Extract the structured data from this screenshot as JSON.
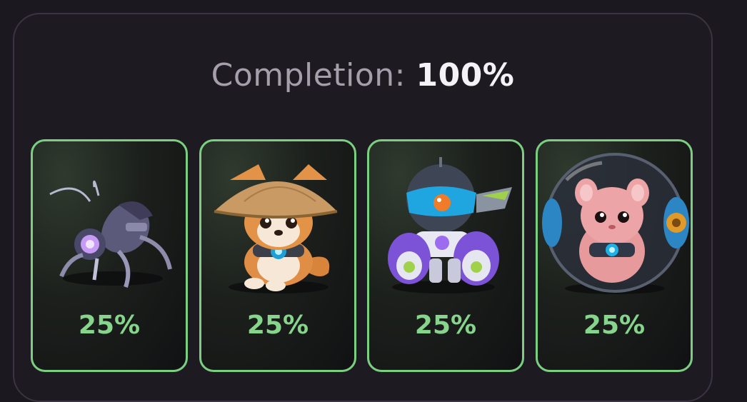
{
  "completion": {
    "label": "Completion:",
    "value": "100%"
  },
  "cards": [
    {
      "icon": "robot-spider-icon",
      "percent": "25%"
    },
    {
      "icon": "shiba-dog-straw-hat-icon",
      "percent": "25%"
    },
    {
      "icon": "space-mech-robot-icon",
      "percent": "25%"
    },
    {
      "icon": "hamster-ball-icon",
      "percent": "25%"
    }
  ],
  "colors": {
    "background": "#1c1820",
    "panel_border": "#3a3442",
    "card_border": "#7bcf80",
    "percent_text": "#87d48c",
    "label_text": "#a59fac",
    "value_text": "#f4f2f6"
  }
}
